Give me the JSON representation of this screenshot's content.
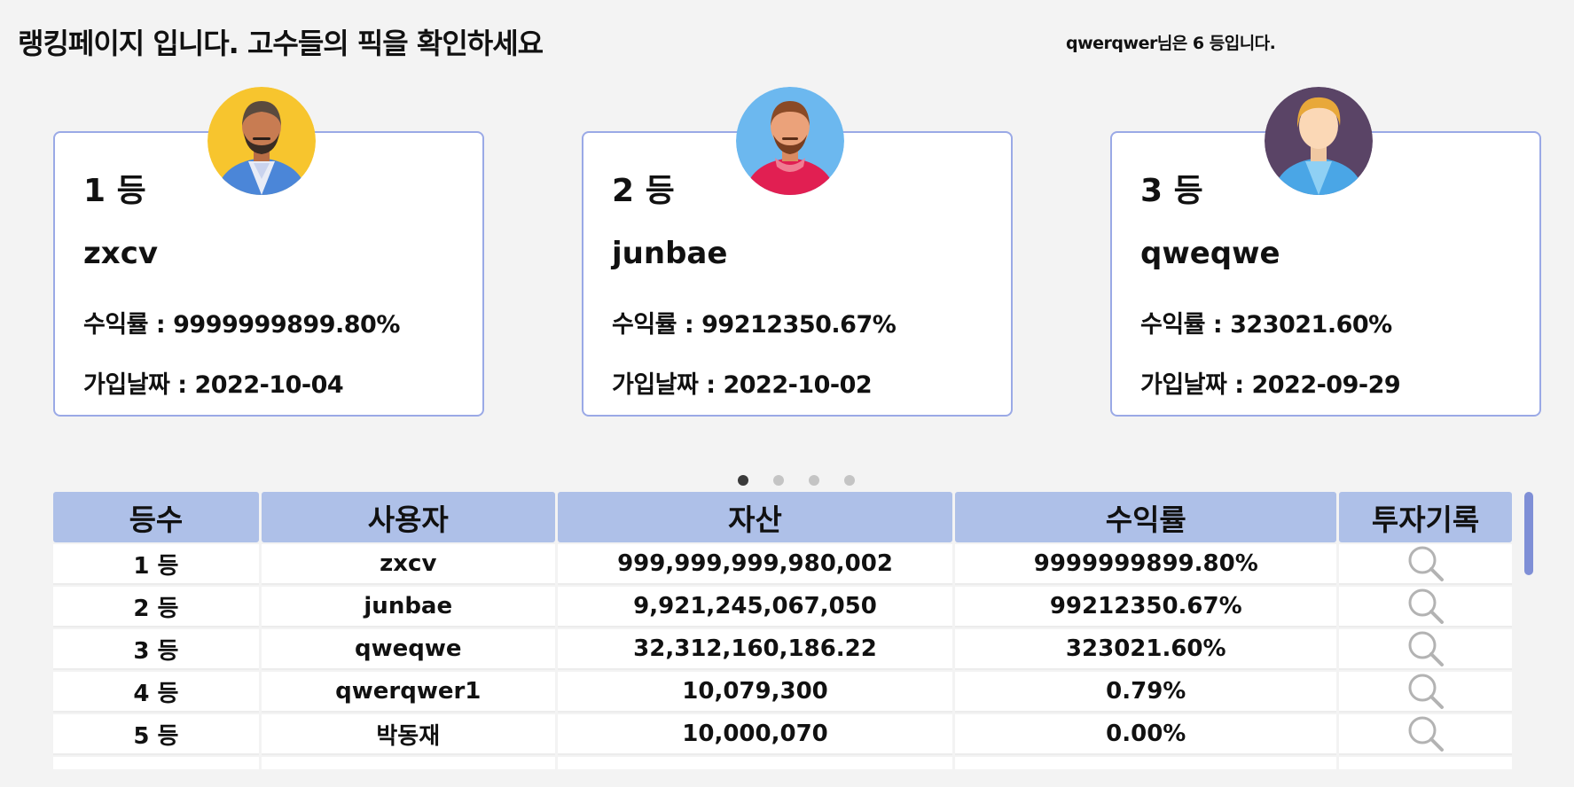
{
  "page": {
    "title": "랭킹페이지 입니다. 고수들의 픽을 확인하세요",
    "my_rank": "qwerqwer님은 6 등입니다."
  },
  "top3": [
    {
      "rank": "1 등",
      "name": "zxcv",
      "rate": "수익률 : 9999999899.80%",
      "joined": "가입날짜 : 2022-10-04",
      "avatar": "man-beard-yellow-bg-avatar"
    },
    {
      "rank": "2 등",
      "name": "junbae",
      "rate": "수익률 : 99212350.67%",
      "joined": "가입날짜 : 2022-10-02",
      "avatar": "man-beard-blue-bg-avatar"
    },
    {
      "rank": "3 등",
      "name": "qweqwe",
      "rate": "수익률 : 323021.60%",
      "joined": "가입날짜 : 2022-09-29",
      "avatar": "man-blond-purple-bg-avatar"
    }
  ],
  "carousel": {
    "count": 4,
    "active": 0
  },
  "table": {
    "headers": [
      "등수",
      "사용자",
      "자산",
      "수익률",
      "투자기록"
    ],
    "rows": [
      {
        "rank": "1 등",
        "user": "zxcv",
        "asset": "999,999,999,980,002",
        "rate": "9999999899.80%"
      },
      {
        "rank": "2 등",
        "user": "junbae",
        "asset": "9,921,245,067,050",
        "rate": "99212350.67%"
      },
      {
        "rank": "3 등",
        "user": "qweqwe",
        "asset": "32,312,160,186.22",
        "rate": "323021.60%"
      },
      {
        "rank": "4 등",
        "user": "qwerqwer1",
        "asset": "10,079,300",
        "rate": "0.79%"
      },
      {
        "rank": "5 등",
        "user": "박동재",
        "asset": "10,000,070",
        "rate": "0.00%"
      }
    ],
    "record_icon": "search-icon"
  },
  "colors": {
    "background": "#f3f3f3",
    "card_border": "#9aa9e6",
    "header_bg": "#aec0e8",
    "scroll_thumb": "#7f8fd6",
    "dot_active": "#3a3a3a",
    "dot_inactive": "#c4c4c4"
  }
}
